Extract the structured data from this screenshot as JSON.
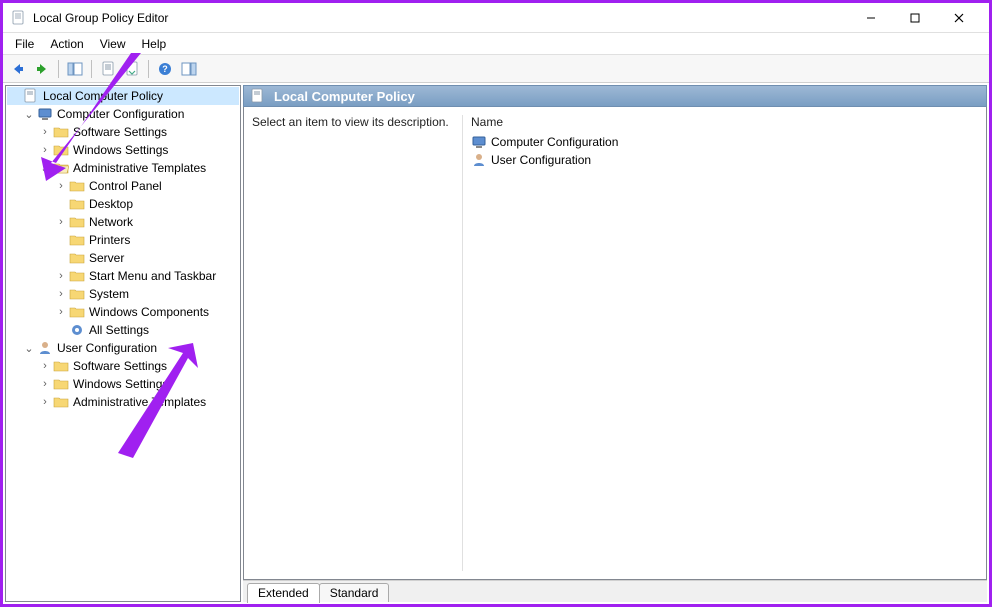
{
  "window": {
    "title": "Local Group Policy Editor"
  },
  "menu": {
    "file": "File",
    "action": "Action",
    "view": "View",
    "help": "Help"
  },
  "toolbar_icons": {
    "back": "back-arrow-icon",
    "forward": "forward-arrow-icon",
    "up": "show-parent-icon",
    "properties": "properties-icon",
    "refresh": "refresh-icon",
    "export": "export-list-icon",
    "help": "help-icon",
    "extra": "show-hide-icon"
  },
  "tree": {
    "root": "Local Computer Policy",
    "computer_config": "Computer Configuration",
    "cc_software": "Software Settings",
    "cc_windows": "Windows Settings",
    "cc_admin": "Administrative Templates",
    "cc_admin_children": {
      "control_panel": "Control Panel",
      "desktop": "Desktop",
      "network": "Network",
      "printers": "Printers",
      "server": "Server",
      "startmenu": "Start Menu and Taskbar",
      "system": "System",
      "components": "Windows Components",
      "all": "All Settings"
    },
    "user_config": "User Configuration",
    "uc_software": "Software Settings",
    "uc_windows": "Windows Settings",
    "uc_admin": "Administrative Templates"
  },
  "detail": {
    "header": "Local Computer Policy",
    "description_prompt": "Select an item to view its description.",
    "list_header": "Name",
    "items": {
      "computer": "Computer Configuration",
      "user": "User Configuration"
    }
  },
  "tabs": {
    "extended": "Extended",
    "standard": "Standard"
  }
}
